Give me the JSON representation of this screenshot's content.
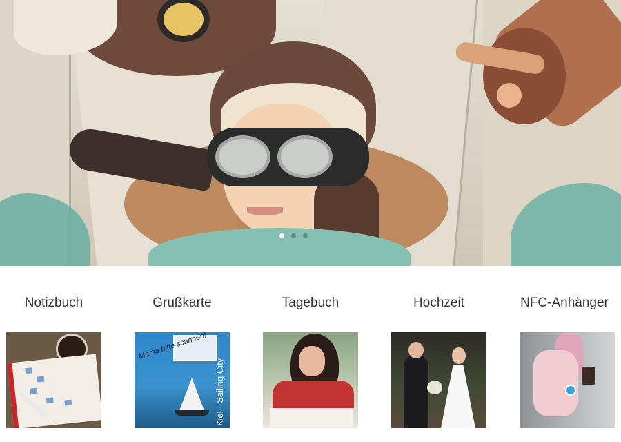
{
  "hero": {
    "alt": "Kind mit Fliegermütze und Schutzbrille",
    "slides_total": 3,
    "active_slide": 1
  },
  "categories": [
    {
      "label": "Notizbuch"
    },
    {
      "label": "Grußkarte",
      "thumb_text": {
        "vertical": "Kiel · Sailing City",
        "script": "Mama bitte scannen!"
      }
    },
    {
      "label": "Tagebuch"
    },
    {
      "label": "Hochzeit"
    },
    {
      "label": "NFC-Anhänger"
    }
  ]
}
